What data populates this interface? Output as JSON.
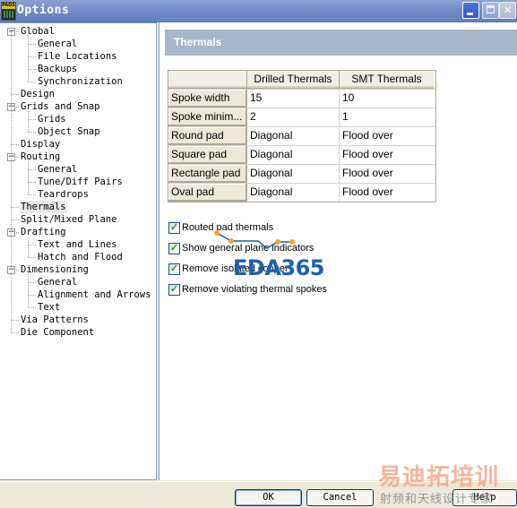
{
  "window": {
    "title": "Options",
    "app_icon_label": "PADS",
    "controls": {
      "minimize": "minimize",
      "maximize": "maximize",
      "close": "close"
    }
  },
  "tree": [
    {
      "label": "Global",
      "level": 0,
      "expander": "−"
    },
    {
      "label": "General",
      "level": 1
    },
    {
      "label": "File Locations",
      "level": 1
    },
    {
      "label": "Backups",
      "level": 1
    },
    {
      "label": "Synchronization",
      "level": 1
    },
    {
      "label": "Design",
      "level": 0
    },
    {
      "label": "Grids and Snap",
      "level": 0,
      "expander": "−"
    },
    {
      "label": "Grids",
      "level": 1
    },
    {
      "label": "Object Snap",
      "level": 1
    },
    {
      "label": "Display",
      "level": 0
    },
    {
      "label": "Routing",
      "level": 0,
      "expander": "−"
    },
    {
      "label": "General",
      "level": 1
    },
    {
      "label": "Tune/Diff Pairs",
      "level": 1
    },
    {
      "label": "Teardrops",
      "level": 1
    },
    {
      "label": "Thermals",
      "level": 0,
      "selected": true
    },
    {
      "label": "Split/Mixed Plane",
      "level": 0
    },
    {
      "label": "Drafting",
      "level": 0,
      "expander": "−"
    },
    {
      "label": "Text and Lines",
      "level": 1
    },
    {
      "label": "Hatch and Flood",
      "level": 1
    },
    {
      "label": "Dimensioning",
      "level": 0,
      "expander": "−"
    },
    {
      "label": "General",
      "level": 1
    },
    {
      "label": "Alignment and Arrows",
      "level": 1
    },
    {
      "label": "Text",
      "level": 1
    },
    {
      "label": "Via Patterns",
      "level": 0
    },
    {
      "label": "Die Component",
      "level": 0
    }
  ],
  "page": {
    "title": "Thermals",
    "grid": {
      "columns": [
        "",
        "Drilled Thermals",
        "SMT Thermals"
      ],
      "rows": [
        {
          "label": "Spoke width",
          "drilled": "15",
          "smt": "10"
        },
        {
          "label": "Spoke minim...",
          "drilled": "2",
          "smt": "1"
        },
        {
          "label": "Round pad",
          "drilled": "Diagonal",
          "smt": "Flood over"
        },
        {
          "label": "Square pad",
          "drilled": "Diagonal",
          "smt": "Flood over"
        },
        {
          "label": "Rectangle pad",
          "drilled": "Diagonal",
          "smt": "Flood over"
        },
        {
          "label": "Oval pad",
          "drilled": "Diagonal",
          "smt": "Flood over"
        }
      ]
    },
    "checkboxes": [
      {
        "label": "Routed pad thermals",
        "checked": true
      },
      {
        "label": "Show general plane indicators",
        "checked": true
      },
      {
        "label": "Remove isolated copper",
        "checked": true
      },
      {
        "label": "Remove violating thermal spokes",
        "checked": true
      }
    ]
  },
  "watermarks": {
    "eda": "EDA365",
    "cn_big": "易迪拓培训",
    "cn_small": "射频和天线设计专家"
  },
  "buttons": {
    "ok": "OK",
    "cancel": "Cancel",
    "help": "Help"
  },
  "colors": {
    "titlebar": "#7690cb",
    "banner": "#a8b6c9",
    "check": "#21a121"
  }
}
